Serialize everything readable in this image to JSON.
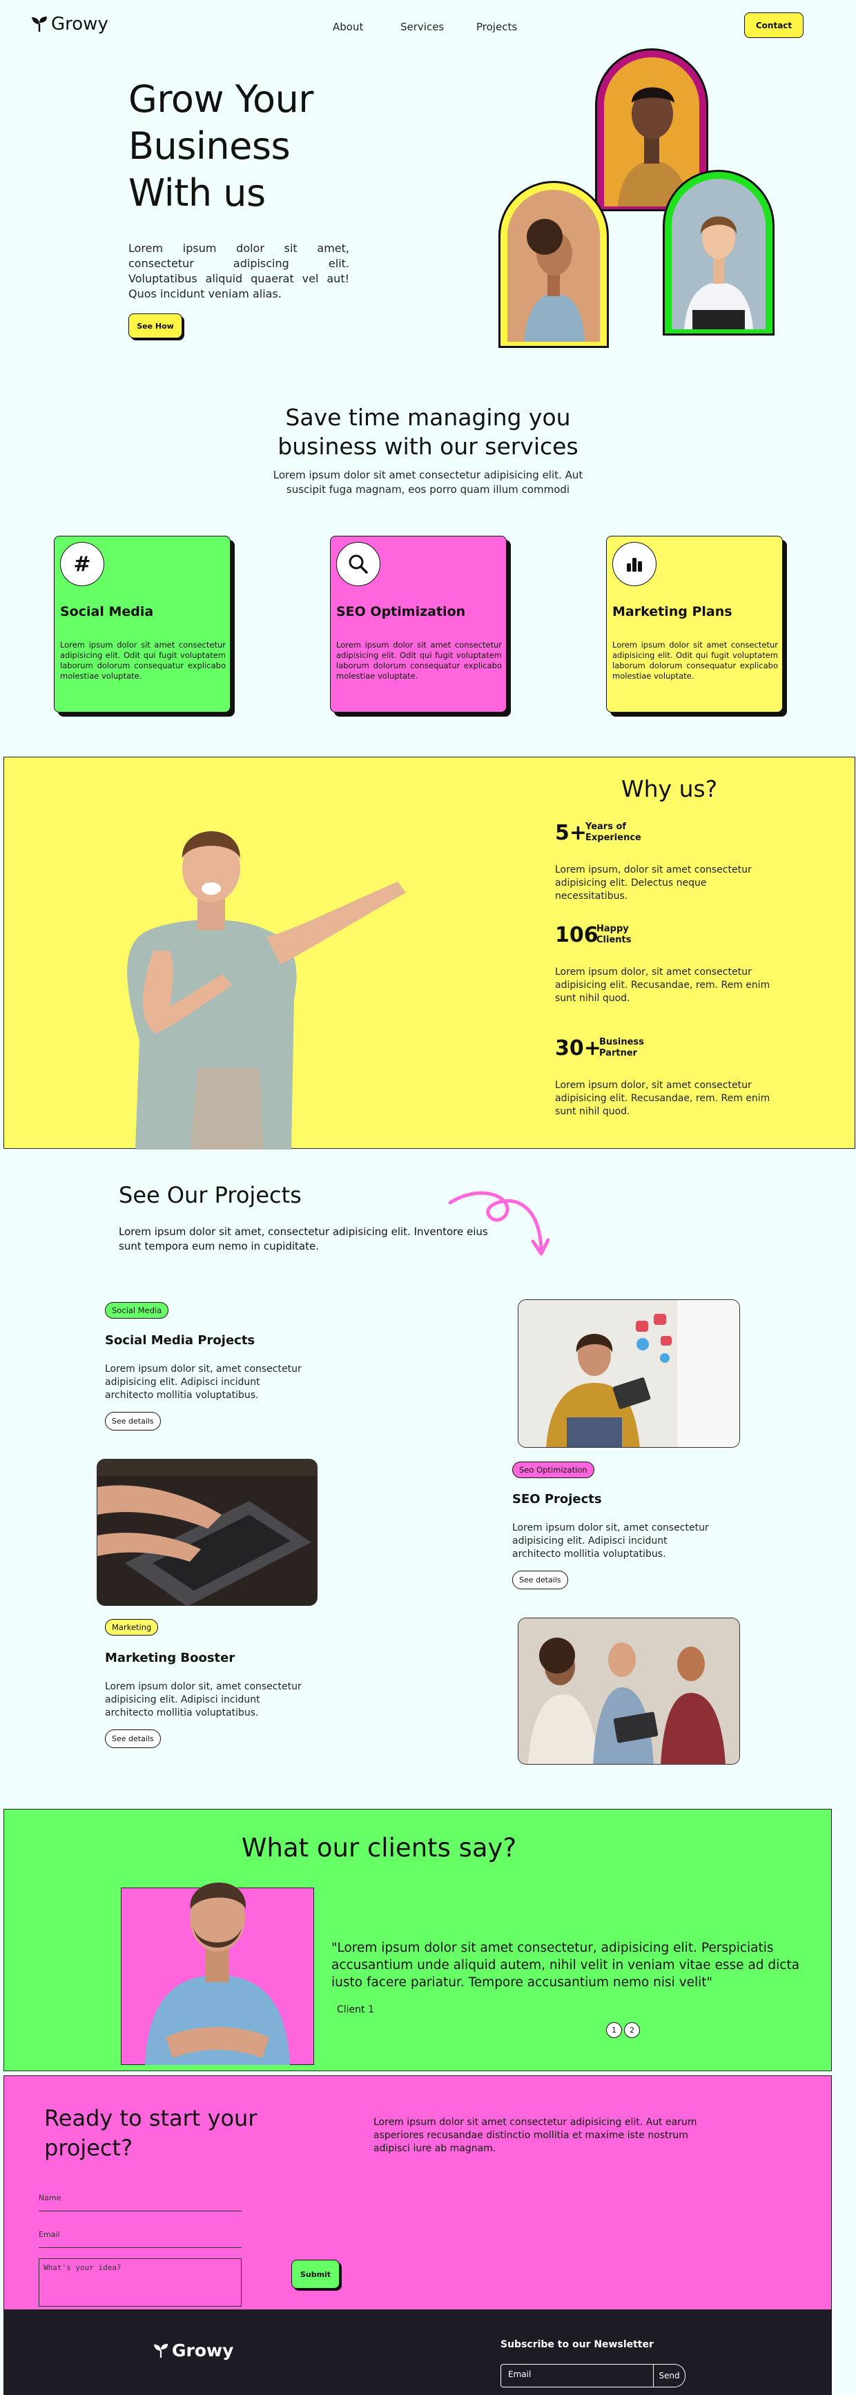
{
  "header": {
    "brand": "Growy",
    "nav": [
      "About",
      "Services",
      "Projects"
    ],
    "contact_label": "Contact"
  },
  "hero": {
    "title_lines": [
      "Grow Your",
      "Business",
      "With us"
    ],
    "text": "Lorem ipsum dolor sit amet, consectetur adipiscing elit. Voluptatibus aliquid quaerat vel aut! Quos incidunt veniam alias.",
    "cta_label": "See How"
  },
  "services": {
    "title_lines": [
      "Save time managing you",
      "business with our services"
    ],
    "subtitle_lines": [
      "Lorem ipsum dolor sit amet consectetur adipisicing elit. Aut",
      "suscipit fuga magnam, eos porro quam illum commodi"
    ],
    "cards": [
      {
        "icon": "#",
        "title": "Social Media",
        "text": "Lorem ipsum dolor sit amet consectetur adipisicing elit. Odit qui fugit voluptatem laborum dolorum consequatur explicabo molestiae voluptate.",
        "color": "#66ff66"
      },
      {
        "icon": "search",
        "title": "SEO Optimization",
        "text": "Lorem ipsum dolor sit amet consectetur adipisicing elit. Odit qui fugit voluptatem laborum dolorum consequatur explicabo molestiae voluptate.",
        "color": "#ff66dd"
      },
      {
        "icon": "bars",
        "title": "Marketing Plans",
        "text": "Lorem ipsum dolor sit amet consectetur adipisicing elit. Odit qui fugit voluptatem laborum dolorum consequatur explicabo molestiae voluptate.",
        "color": "#fffb66"
      }
    ]
  },
  "why": {
    "title": "Why us?",
    "stats": [
      {
        "num": "5+",
        "label_lines": [
          "Years of",
          "Experience"
        ],
        "text": "Lorem ipsum, dolor sit amet consectetur adipisicing elit. Delectus neque necessitatibus."
      },
      {
        "num": "106",
        "label_lines": [
          "Happy",
          "Clients"
        ],
        "text": "Lorem ipsum dolor, sit amet consectetur adipisicing elit. Recusandae, rem. Rem enim sunt nihil quod."
      },
      {
        "num": "30+",
        "label_lines": [
          "Business",
          "Partner"
        ],
        "text": "Lorem ipsum dolor, sit amet consectetur adipisicing elit. Recusandae, rem. Rem enim sunt nihil quod."
      }
    ]
  },
  "projects": {
    "title": "See Our Projects",
    "subtitle": "Lorem ipsum dolor sit amet, consectetur adipisicing elit. Inventore eius sunt tempora eum nemo in cupiditate.",
    "items": [
      {
        "tag": "Social Media",
        "title": "Social Media Projects",
        "text": "Lorem ipsum dolor sit, amet consectetur adipisicing elit. Adipisci incidunt architecto mollitia voluptatibus.",
        "details": "See details"
      },
      {
        "tag": "Seo Optimization",
        "title": "SEO Projects",
        "text": "Lorem ipsum dolor sit, amet consectetur adipisicing elit. Adipisci incidunt architecto mollitia voluptatibus.",
        "details": "See details"
      },
      {
        "tag": "Marketing",
        "title": "Marketing Booster",
        "text": "Lorem ipsum dolor sit, amet consectetur adipisicing elit. Adipisci incidunt architecto mollitia voluptatibus.",
        "details": "See details"
      }
    ]
  },
  "clients": {
    "title": "What our clients say?",
    "quote": "\"Lorem ipsum dolor sit amet consectetur, adipisicing elit. Perspiciatis accusantium unde aliquid autem, nihil velit in veniam vitae esse ad dicta iusto facere pariatur. Tempore accusantium nemo nisi velit\"",
    "client": "Client 1",
    "pages": [
      "1",
      "2"
    ]
  },
  "cta": {
    "title_lines": [
      "Ready to start your",
      "project?"
    ],
    "text": "Lorem ipsum dolor sit amet consectetur adipisicing elit. Aut earum asperiores recusandae distinctio mollitia et maxime iste nostrum adipisci iure ab magnam.",
    "name_placeholder": "Name",
    "email_placeholder": "Email",
    "idea_placeholder": "What's your idea?",
    "submit_label": "Submit"
  },
  "footer": {
    "brand": "Growy",
    "newsletter_title": "Subscribe to our Newsletter",
    "email_placeholder": "Email",
    "send_label": "Send"
  },
  "colors": {
    "green": "#66ff66",
    "pink": "#ff66dd",
    "yellow": "#fffb66",
    "dark": "#1c1c24",
    "magenta": "#b5137a"
  }
}
